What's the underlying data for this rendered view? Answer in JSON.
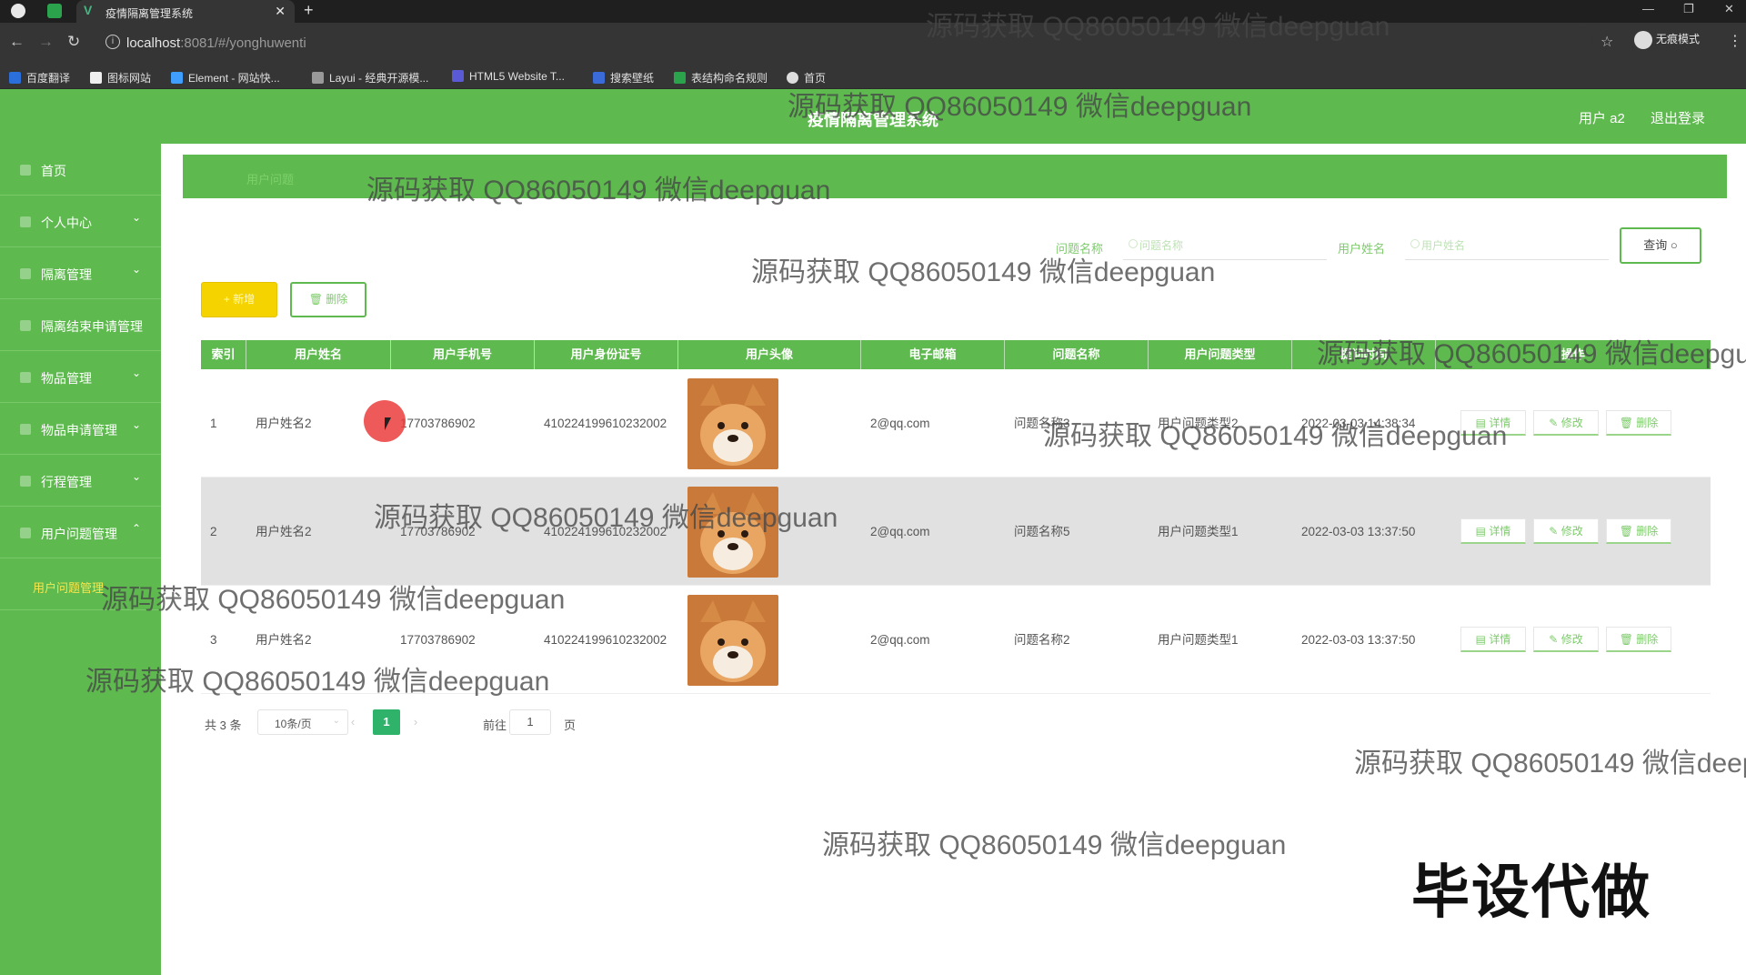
{
  "browser": {
    "tab_title": "疫情隔离管理系统",
    "url_host": "localhost",
    "url_path": ":8081/#/yonghuwenti",
    "incognito_label": "无痕模式",
    "bookmarks": [
      "百度翻译",
      "图标网站",
      "Element - 网站快...",
      "Layui - 经典开源模...",
      "HTML5 Website T...",
      "搜索壁纸",
      "表结构命名规则",
      "首页"
    ]
  },
  "header": {
    "title": "疫情隔离管理系统",
    "user": "用户 a2",
    "logout": "退出登录"
  },
  "sidebar": {
    "items": [
      {
        "label": "首页",
        "arrow": ""
      },
      {
        "label": "个人中心",
        "arrow": "⌄"
      },
      {
        "label": "隔离管理",
        "arrow": "⌄"
      },
      {
        "label": "隔离结束申请管理",
        "arrow": ""
      },
      {
        "label": "物品管理",
        "arrow": "⌄"
      },
      {
        "label": "物品申请管理",
        "arrow": "⌄"
      },
      {
        "label": "行程管理",
        "arrow": "⌄"
      },
      {
        "label": "用户问题管理",
        "arrow": "⌃"
      }
    ],
    "active_sub": "用户问题管理"
  },
  "breadcrumb": "用户问题",
  "search": {
    "label1": "问题名称",
    "placeholder1": "问题名称",
    "label2": "用户姓名",
    "placeholder2": "用户姓名",
    "button": "查询"
  },
  "actions": {
    "add": "+ 新增",
    "delete": "🗑 删除"
  },
  "table": {
    "headers": [
      "索引",
      "用户姓名",
      "用户手机号",
      "用户身份证号",
      "用户头像",
      "电子邮箱",
      "问题名称",
      "用户问题类型",
      "提问时间",
      "操作"
    ],
    "rows": [
      {
        "idx": "1",
        "name": "用户姓名2",
        "phone": "17703786902",
        "idcard": "410224199610232002",
        "email": "2@qq.com",
        "question": "问题名称3",
        "type": "用户问题类型2",
        "time": "2022-03-03 14:38:34"
      },
      {
        "idx": "2",
        "name": "用户姓名2",
        "phone": "17703786902",
        "idcard": "410224199610232002",
        "email": "2@qq.com",
        "question": "问题名称5",
        "type": "用户问题类型1",
        "time": "2022-03-03 13:37:50"
      },
      {
        "idx": "3",
        "name": "用户姓名2",
        "phone": "17703786902",
        "idcard": "410224199610232002",
        "email": "2@qq.com",
        "question": "问题名称2",
        "type": "用户问题类型1",
        "time": "2022-03-03 13:37:50"
      }
    ],
    "ops": {
      "detail": "详情",
      "edit": "修改",
      "delete": "删除"
    }
  },
  "pagination": {
    "total": "共 3 条",
    "page_size": "10条/页",
    "current": "1",
    "goto": "前往",
    "goto_value": "1",
    "unit": "页"
  },
  "overlay": {
    "watermark": "源码获取 QQ86050149 微信deepguan",
    "stamp": "毕设代做"
  },
  "colors": {
    "primary_green": "#5eb94e",
    "add_yellow": "#f5d300",
    "page_active": "#2fb36a"
  }
}
